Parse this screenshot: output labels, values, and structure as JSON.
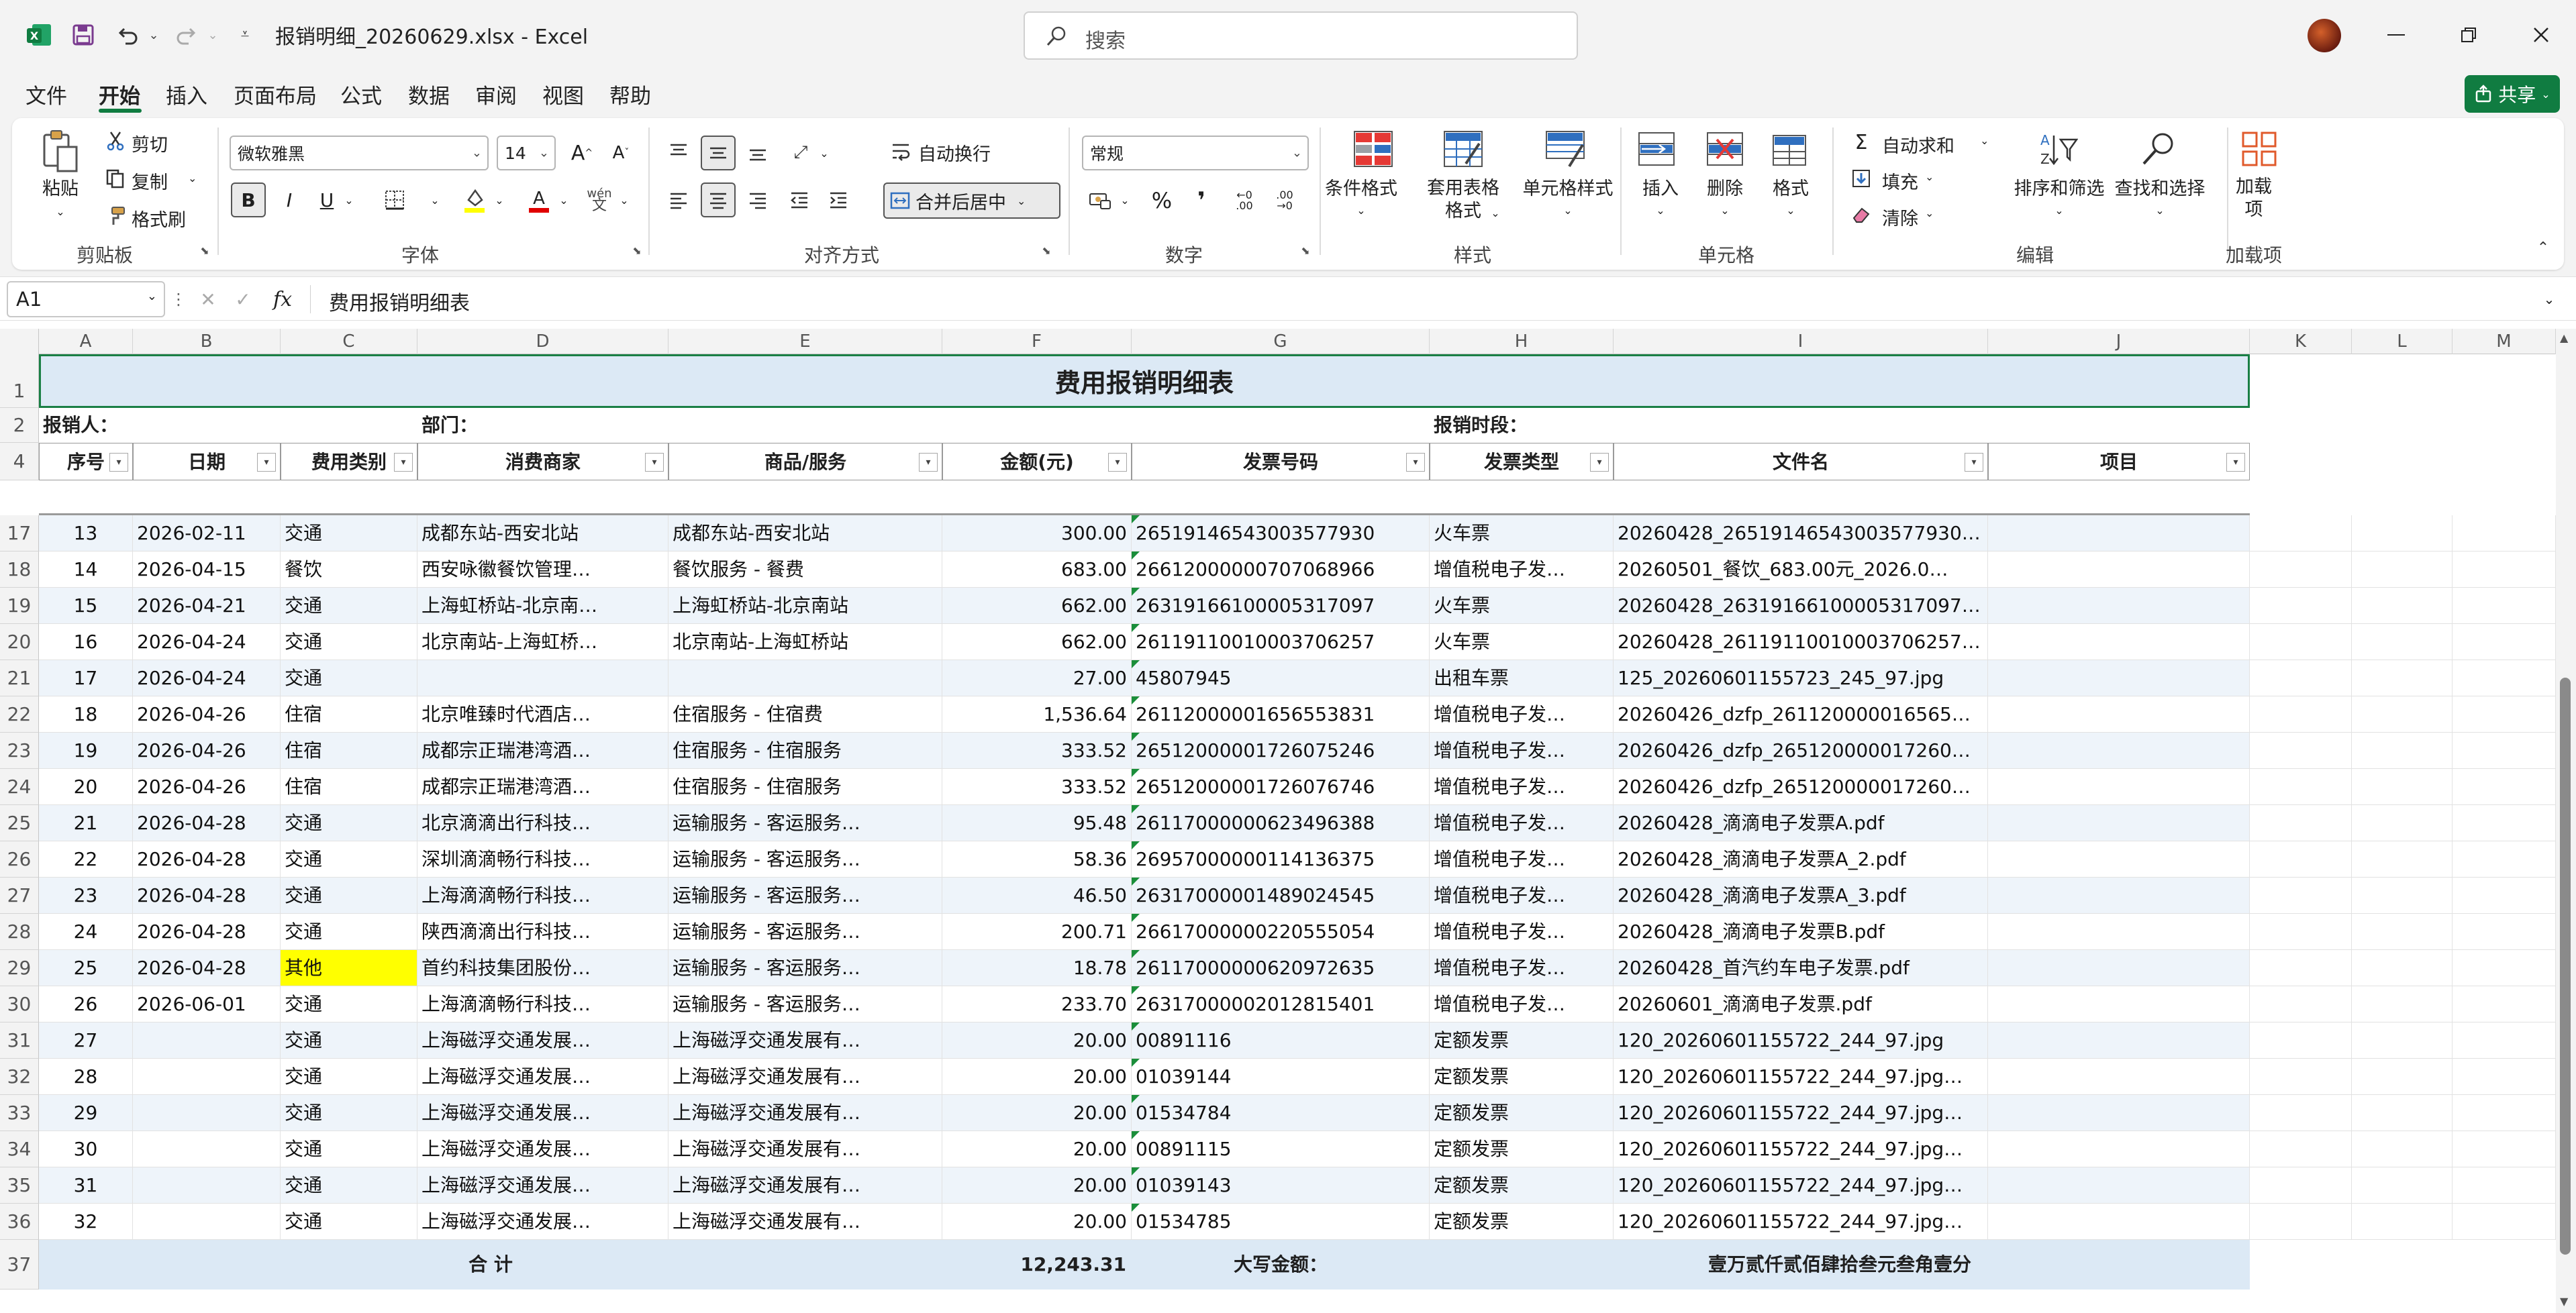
{
  "window": {
    "title": "报销明细_20260629.xlsx  -  Excel",
    "search_placeholder": "搜索"
  },
  "menu": {
    "items": [
      "文件",
      "开始",
      "插入",
      "页面布局",
      "公式",
      "数据",
      "审阅",
      "视图",
      "帮助"
    ],
    "active": "开始",
    "share": "共享"
  },
  "ribbon": {
    "clipboard": {
      "label": "剪贴板",
      "paste": "粘贴",
      "cut": "剪切",
      "copy": "复制",
      "format_painter": "格式刷"
    },
    "font": {
      "label": "字体",
      "font_name": "微软雅黑",
      "font_size": "14"
    },
    "alignment": {
      "label": "对齐方式",
      "wrap": "自动换行",
      "merge": "合并后居中"
    },
    "number": {
      "label": "数字",
      "format": "常规"
    },
    "styles": {
      "label": "样式",
      "conditional": "条件格式",
      "table_fmt": "套用表格格式",
      "cell_styles": "单元格样式"
    },
    "cells": {
      "label": "单元格",
      "insert": "插入",
      "delete": "删除",
      "format": "格式"
    },
    "editing": {
      "label": "编辑",
      "autosum": "自动求和",
      "fill": "填充",
      "clear": "清除",
      "sort": "排序和筛选",
      "find": "查找和选择"
    },
    "addins": {
      "label": "加载项",
      "addin": "加载项"
    }
  },
  "formula_bar": {
    "cell_ref": "A1",
    "content": "费用报销明细表"
  },
  "sheet": {
    "columns": [
      "A",
      "B",
      "C",
      "D",
      "E",
      "F",
      "G",
      "H",
      "I",
      "J",
      "K",
      "L",
      "M"
    ],
    "title": "费用报销明细表",
    "info": {
      "reporter": "报销人：",
      "dept": "部门：",
      "period": "报销时段："
    },
    "headers": [
      "序号",
      "日期",
      "费用类别",
      "消费商家",
      "商品/服务",
      "金额(元)",
      "发票号码",
      "发票类型",
      "文件名",
      "项目"
    ],
    "row_numbers": [
      "1",
      "2",
      "4",
      "17",
      "18",
      "19",
      "20",
      "21",
      "22",
      "23",
      "24",
      "25",
      "26",
      "27",
      "28",
      "29",
      "30",
      "31",
      "32",
      "33",
      "34",
      "35",
      "36",
      "37"
    ],
    "rows": [
      [
        "13",
        "2026-02-11",
        "交通",
        "成都东站-西安北站",
        "成都东站-西安北站",
        "300.00",
        "26519146543003577930",
        "火车票",
        "20260428_26519146543003577930…"
      ],
      [
        "14",
        "2026-04-15",
        "餐饮",
        "西安咏徽餐饮管理…",
        "餐饮服务 - 餐费",
        "683.00",
        "26612000000707068966",
        "增值税电子发…",
        "20260501_餐饮_683.00元_2026.0…"
      ],
      [
        "15",
        "2026-04-21",
        "交通",
        "上海虹桥站-北京南…",
        "上海虹桥站-北京南站",
        "662.00",
        "26319166100005317097",
        "火车票",
        "20260428_26319166100005317097…"
      ],
      [
        "16",
        "2026-04-24",
        "交通",
        "北京南站-上海虹桥…",
        "北京南站-上海虹桥站",
        "662.00",
        "26119110010003706257",
        "火车票",
        "20260428_26119110010003706257…"
      ],
      [
        "17",
        "2026-04-24",
        "交通",
        "",
        "",
        "27.00",
        "45807945",
        "出租车票",
        "125_20260601155723_245_97.jpg"
      ],
      [
        "18",
        "2026-04-26",
        "住宿",
        "北京唯臻时代酒店…",
        "住宿服务 - 住宿费",
        "1,536.64",
        "26112000001656553831",
        "增值税电子发…",
        "20260426_dzfp_261120000016565…"
      ],
      [
        "19",
        "2026-04-26",
        "住宿",
        "成都宗正瑞港湾酒…",
        "住宿服务 - 住宿服务",
        "333.52",
        "26512000001726075246",
        "增值税电子发…",
        "20260426_dzfp_265120000017260…"
      ],
      [
        "20",
        "2026-04-26",
        "住宿",
        "成都宗正瑞港湾酒…",
        "住宿服务 - 住宿服务",
        "333.52",
        "26512000001726076746",
        "增值税电子发…",
        "20260426_dzfp_265120000017260…"
      ],
      [
        "21",
        "2026-04-28",
        "交通",
        "北京滴滴出行科技…",
        "运输服务 - 客运服务…",
        "95.48",
        "26117000000623496388",
        "增值税电子发…",
        "20260428_滴滴电子发票A.pdf"
      ],
      [
        "22",
        "2026-04-28",
        "交通",
        "深圳滴滴畅行科技…",
        "运输服务 - 客运服务…",
        "58.36",
        "26957000000114136375",
        "增值税电子发…",
        "20260428_滴滴电子发票A_2.pdf"
      ],
      [
        "23",
        "2026-04-28",
        "交通",
        "上海滴滴畅行科技…",
        "运输服务 - 客运服务…",
        "46.50",
        "26317000001489024545",
        "增值税电子发…",
        "20260428_滴滴电子发票A_3.pdf"
      ],
      [
        "24",
        "2026-04-28",
        "交通",
        "陕西滴滴出行科技…",
        "运输服务 - 客运服务…",
        "200.71",
        "26617000000220555054",
        "增值税电子发…",
        "20260428_滴滴电子发票B.pdf"
      ],
      [
        "25",
        "2026-04-28",
        "其他",
        "首约科技集团股份…",
        "运输服务 - 客运服务…",
        "18.78",
        "26117000000620972635",
        "增值税电子发…",
        "20260428_首汽约车电子发票.pdf"
      ],
      [
        "26",
        "2026-06-01",
        "交通",
        "上海滴滴畅行科技…",
        "运输服务 - 客运服务…",
        "233.70",
        "26317000002012815401",
        "增值税电子发…",
        "20260601_滴滴电子发票.pdf"
      ],
      [
        "27",
        "",
        "交通",
        "上海磁浮交通发展…",
        "上海磁浮交通发展有…",
        "20.00",
        "00891116",
        "定额发票",
        "120_20260601155722_244_97.jpg"
      ],
      [
        "28",
        "",
        "交通",
        "上海磁浮交通发展…",
        "上海磁浮交通发展有…",
        "20.00",
        "01039144",
        "定额发票",
        "120_20260601155722_244_97.jpg…"
      ],
      [
        "29",
        "",
        "交通",
        "上海磁浮交通发展…",
        "上海磁浮交通发展有…",
        "20.00",
        "01534784",
        "定额发票",
        "120_20260601155722_244_97.jpg…"
      ],
      [
        "30",
        "",
        "交通",
        "上海磁浮交通发展…",
        "上海磁浮交通发展有…",
        "20.00",
        "00891115",
        "定额发票",
        "120_20260601155722_244_97.jpg…"
      ],
      [
        "31",
        "",
        "交通",
        "上海磁浮交通发展…",
        "上海磁浮交通发展有…",
        "20.00",
        "01039143",
        "定额发票",
        "120_20260601155722_244_97.jpg…"
      ],
      [
        "32",
        "",
        "交通",
        "上海磁浮交通发展…",
        "上海磁浮交通发展有…",
        "20.00",
        "01534785",
        "定额发票",
        "120_20260601155722_244_97.jpg…"
      ]
    ],
    "totals": {
      "label": "合    计",
      "amount": "12,243.31",
      "uppercase_label": "大写金额：",
      "uppercase_value": "壹万贰仟贰佰肆拾叁元叁角壹分"
    },
    "highlight_color": "#ffff00",
    "title_fill": "#dce9f5"
  }
}
